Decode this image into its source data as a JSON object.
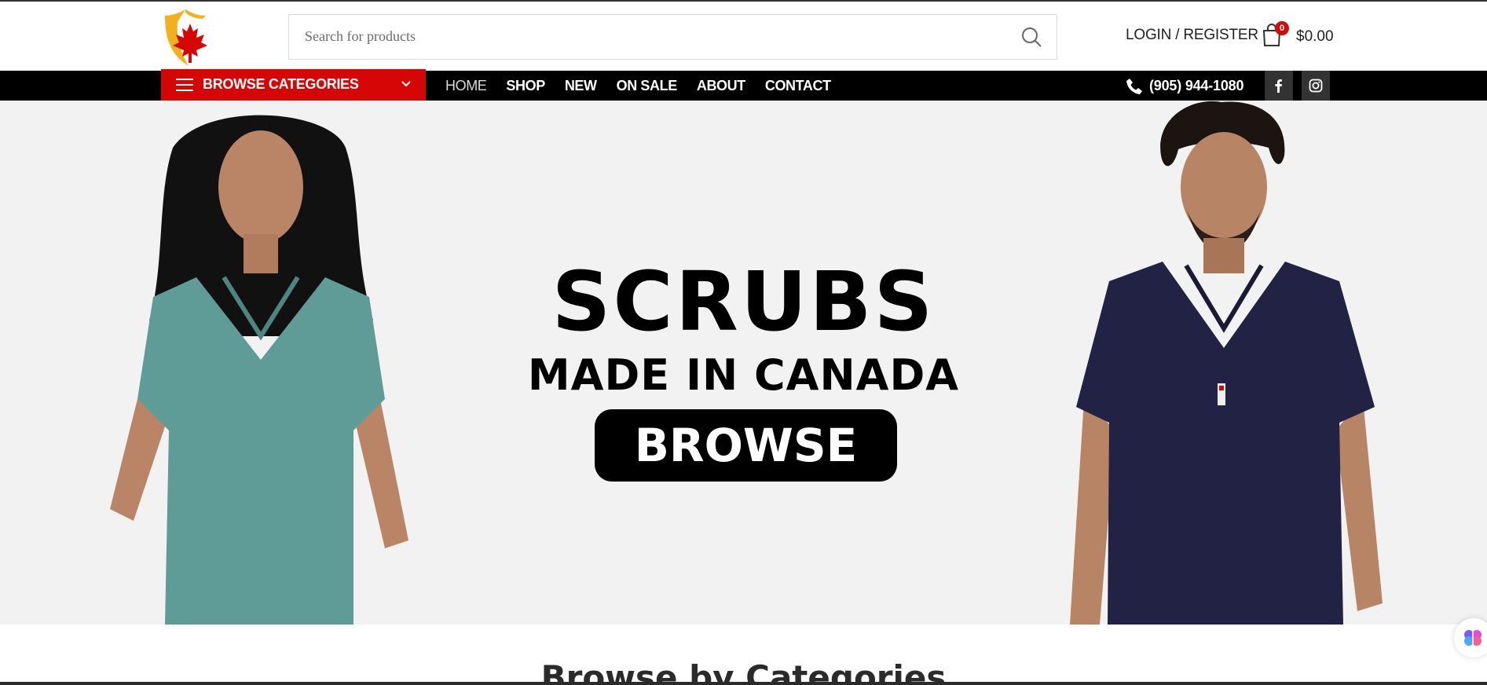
{
  "header": {
    "logo_name": "maple-leaf-shield-logo",
    "search_placeholder": "Search for products",
    "login_label": "LOGIN / REGISTER",
    "cart_count": "0",
    "cart_total": "$0.00"
  },
  "navbar": {
    "browse_categories_label": "BROWSE CATEGORIES",
    "menu": [
      {
        "label": "HOME",
        "active": true
      },
      {
        "label": "SHOP"
      },
      {
        "label": "NEW"
      },
      {
        "label": "ON SALE"
      },
      {
        "label": "ABOUT"
      },
      {
        "label": "CONTACT"
      }
    ],
    "phone": "(905) 944-1080",
    "social": [
      "facebook-icon",
      "instagram-icon"
    ]
  },
  "hero": {
    "title": "SCRUBS",
    "subtitle": "MADE IN CANADA",
    "button_label": "BROWSE",
    "left_scrub_color": "#5f9b97",
    "right_scrub_color": "#222244"
  },
  "sections": {
    "categories_title": "Browse by Categories"
  },
  "colors": {
    "accent_red": "#d40606",
    "nav_bg": "#000000",
    "hero_bg": "#f2f2f2"
  }
}
